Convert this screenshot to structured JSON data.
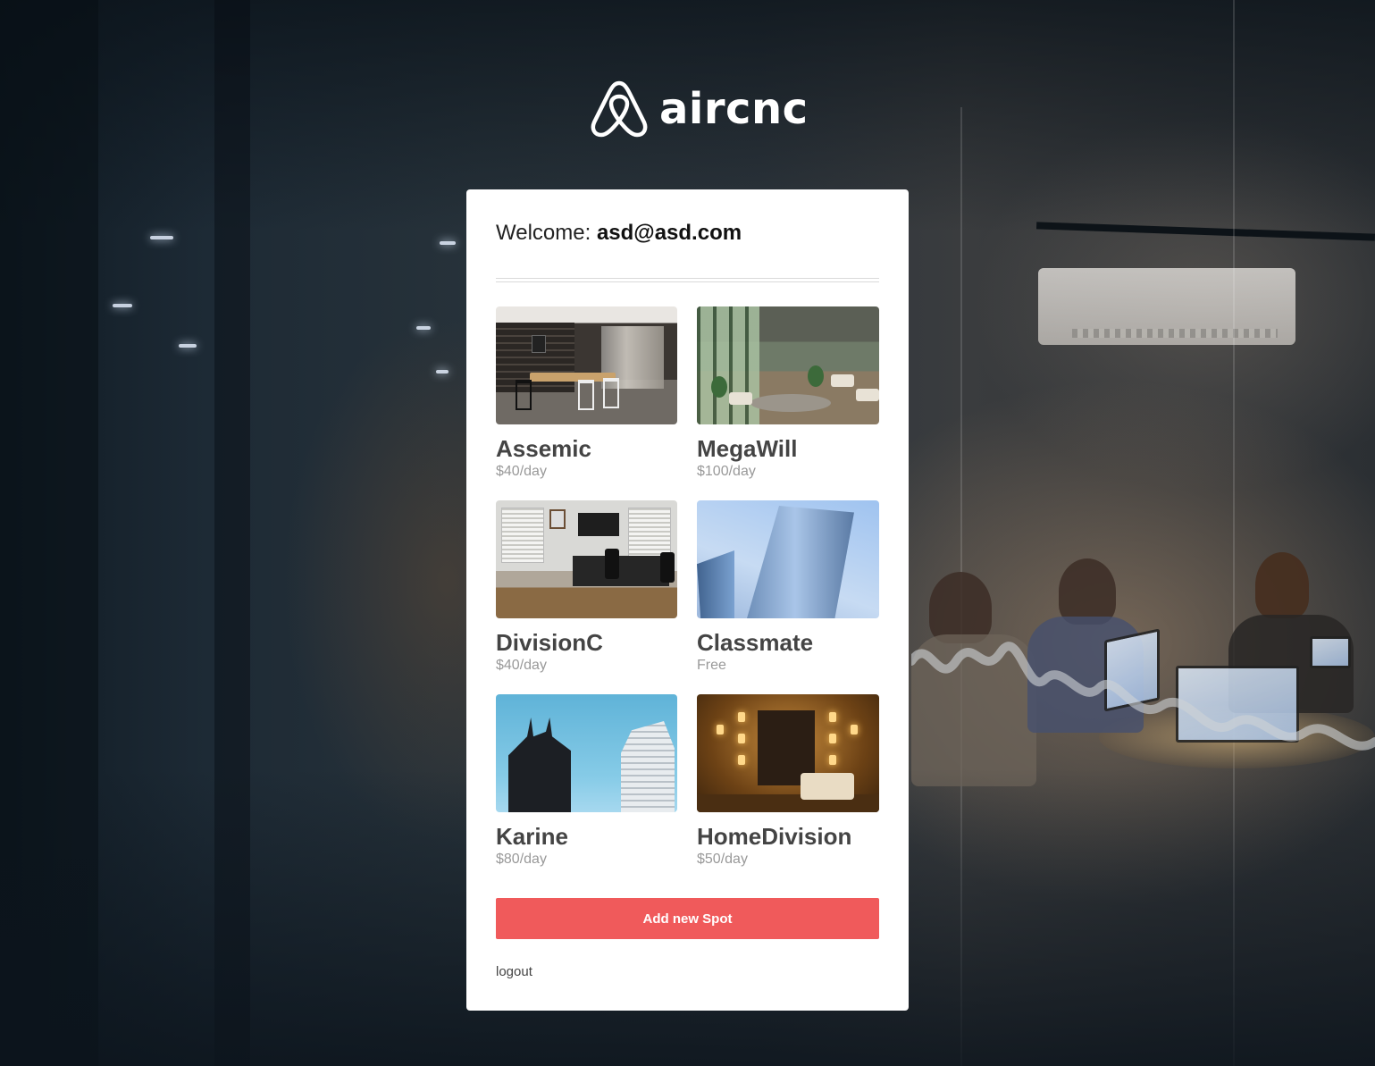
{
  "brand": {
    "name": "aircnc"
  },
  "welcome": {
    "label": "Welcome:",
    "email": "asd@asd.com"
  },
  "spots": [
    {
      "name": "Assemic",
      "price": "$40/day"
    },
    {
      "name": "MegaWill",
      "price": "$100/day"
    },
    {
      "name": "DivisionC",
      "price": "$40/day"
    },
    {
      "name": "Classmate",
      "price": "Free"
    },
    {
      "name": "Karine",
      "price": "$80/day"
    },
    {
      "name": "HomeDivision",
      "price": "$50/day"
    }
  ],
  "actions": {
    "add_spot": "Add new Spot",
    "logout": "logout"
  },
  "colors": {
    "accent": "#f05a5b",
    "card_background": "#ffffff",
    "spot_title": "#444444",
    "spot_price": "#999999"
  },
  "icons": {
    "logo": "airbnb-belo-icon"
  }
}
